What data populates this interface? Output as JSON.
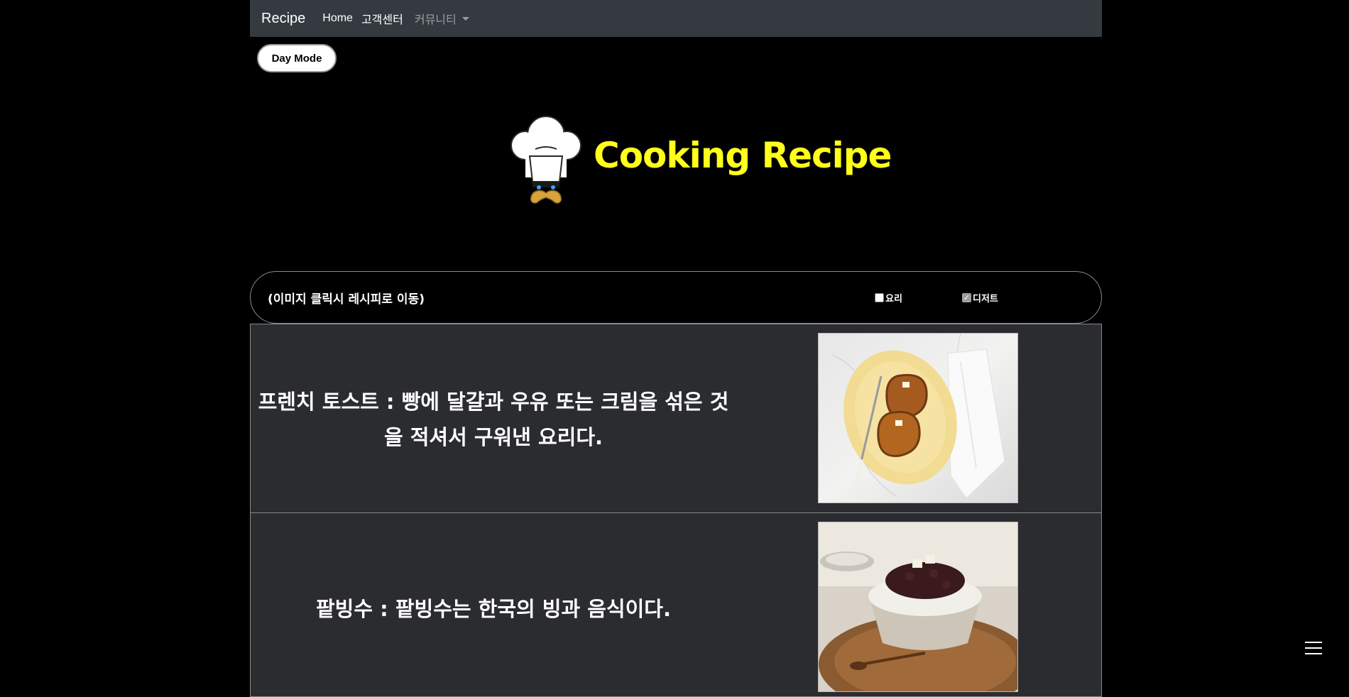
{
  "navbar": {
    "brand": "Recipe",
    "links": [
      "Home",
      "고객센터"
    ],
    "community_label": "커뮤니티",
    "background": "#343a40"
  },
  "day_mode_button": "Day Mode",
  "logo": {
    "title": "Cooking Recipe",
    "title_color": "#ffff1a",
    "icon": "chef-hat-mustache-icon"
  },
  "filter": {
    "hint": "(이미지 클릭시 레시피로 이동)",
    "options": [
      {
        "label": "요리",
        "checked": false
      },
      {
        "label": "디저트",
        "checked": true
      }
    ]
  },
  "recipes": [
    {
      "text": "프렌치 토스트 : 빵에 달걀과 우유 또는 크림을 섞은 것을 적셔서 구워낸 요리다.",
      "image": "french-toast-photo"
    },
    {
      "text": "팥빙수 : 팥빙수는 한국의 빙과 음식이다.",
      "image": "patbingsu-photo"
    }
  ],
  "floating_menu_icon": "hamburger-menu-icon"
}
